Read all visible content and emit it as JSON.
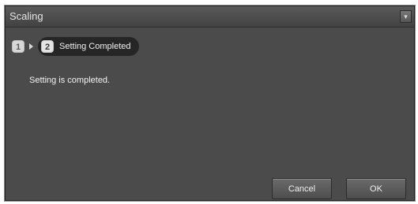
{
  "window": {
    "title": "Scaling"
  },
  "steps": {
    "step1_number": "1",
    "step2_number": "2",
    "current_label": "Setting Completed"
  },
  "message": "Setting is completed.",
  "buttons": {
    "cancel_label": "Cancel",
    "ok_label": "OK"
  },
  "colors": {
    "background": "#4b4b4b",
    "step_pill": "#262626",
    "text": "#f0f0f0"
  }
}
